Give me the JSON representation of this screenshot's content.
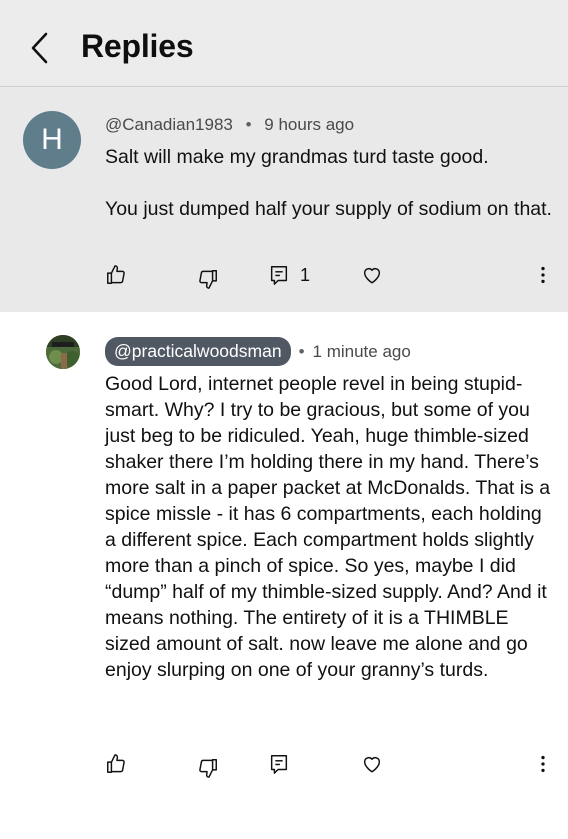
{
  "header": {
    "title": "Replies",
    "back_icon": "chevron-left-icon"
  },
  "parent_comment": {
    "avatar_letter": "H",
    "avatar_color": "#607d8b",
    "handle": "@Canadian1983",
    "separator": "•",
    "time": "9 hours ago",
    "paragraphs": [
      "Salt will make my grandmas turd taste good.",
      "You just dumped half your supply of sodium on that."
    ],
    "reply_count": "1"
  },
  "reply_comment": {
    "handle": "@practicalwoodsman",
    "separator": "•",
    "time": "1 minute ago",
    "text": "Good Lord, internet people revel in being stupid-smart. Why? I try to be gracious, but some of you just beg to be ridiculed. Yeah, huge thimble-sized shaker there I’m holding there in my hand. There’s more salt in a paper packet at McDonalds. That is a spice missle - it has 6 compartments, each holding a different spice. Each compartment holds slightly more than a pinch of spice. So yes, maybe I did “dump” half of my thimble-sized supply. And? And it means nothing. The entirety of it is a THIMBLE sized amount of salt. now leave me alone and go enjoy slurping on one of your granny’s turds."
  }
}
